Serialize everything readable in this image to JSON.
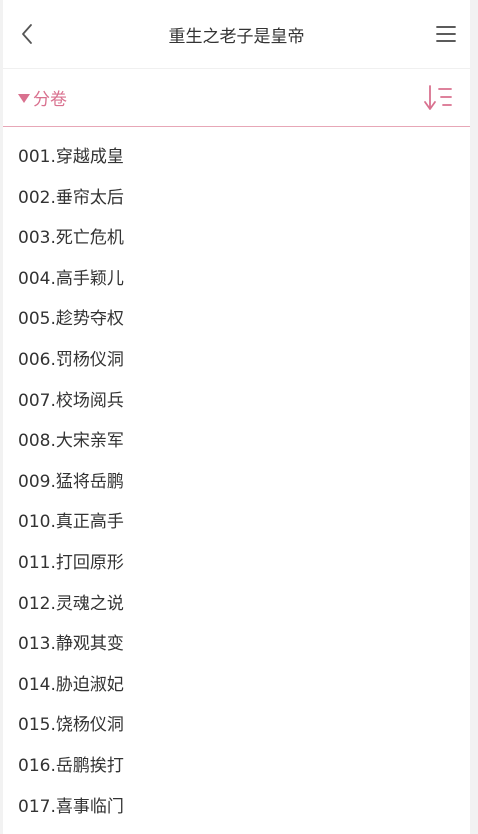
{
  "header": {
    "title": "重生之老子是皇帝",
    "back_icon": "chevron-left-icon",
    "menu_icon": "hamburger-menu-icon"
  },
  "toolbar": {
    "volume_label": "分卷",
    "volume_icon": "caret-down-icon",
    "sort_icon": "sort-order-icon"
  },
  "colors": {
    "accent": "#d9718f",
    "divider": "#e7a7b7",
    "text": "#333333"
  },
  "chapters": [
    "001.穿越成皇",
    "002.垂帘太后",
    "003.死亡危机",
    "004.高手颖儿",
    "005.趁势夺权",
    "006.罚杨仪洞",
    "007.校场阅兵",
    "008.大宋亲军",
    "009.猛将岳鹏",
    "010.真正高手",
    "011.打回原形",
    "012.灵魂之说",
    "013.静观其变",
    "014.胁迫淑妃",
    "015.饶杨仪洞",
    "016.岳鹏挨打",
    "017.喜事临门"
  ]
}
